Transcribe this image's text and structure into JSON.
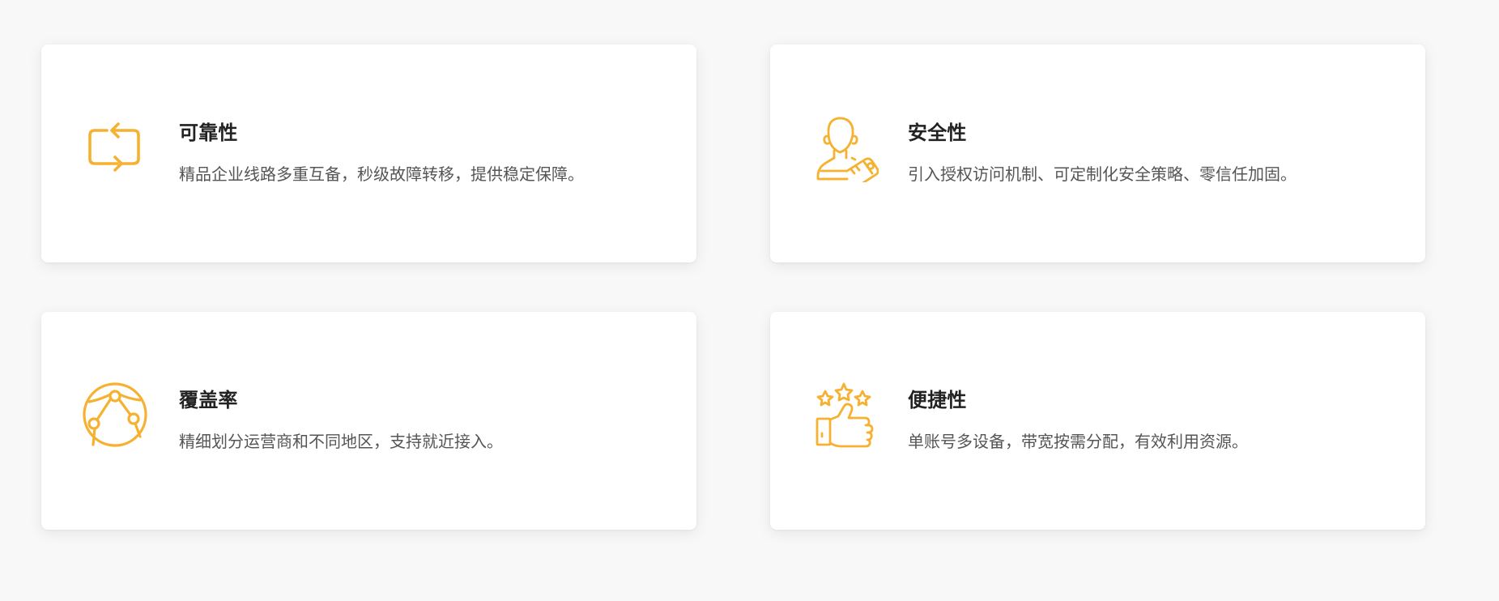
{
  "features": [
    {
      "title": "可靠性",
      "description": "精品企业线路多重互备，秒级故障转移，提供稳定保障。",
      "icon": "repeat-icon"
    },
    {
      "title": "安全性",
      "description": "引入授权访问机制、可定制化安全策略、零信任加固。",
      "icon": "user-key-icon"
    },
    {
      "title": "覆盖率",
      "description": "精细划分运营商和不同地区，支持就近接入。",
      "icon": "network-globe-icon"
    },
    {
      "title": "便捷性",
      "description": "单账号多设备，带宽按需分配，有效利用资源。",
      "icon": "thumbs-up-stars-icon"
    }
  ],
  "colors": {
    "accent": "#f5b12f",
    "title": "#222222",
    "text": "#555555",
    "card": "#ffffff",
    "background": "#f8f8f8"
  }
}
